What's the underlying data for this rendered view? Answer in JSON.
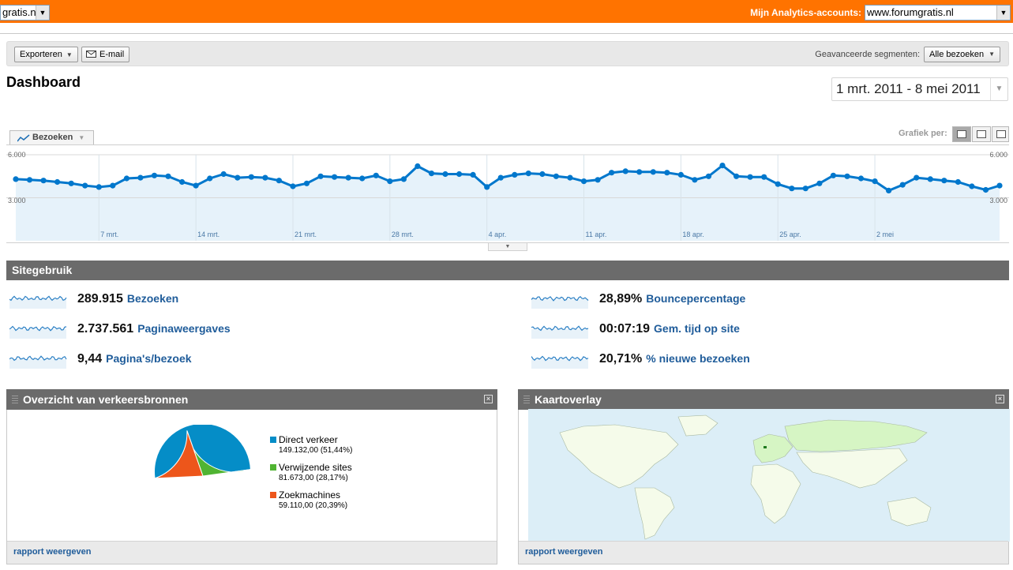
{
  "topbar": {
    "profile_select": "gratis.nl",
    "accounts_label": "Mijn Analytics-accounts:",
    "accounts_select": "www.forumgratis.nl"
  },
  "toolbar": {
    "export_label": "Exporteren",
    "email_label": "E-mail",
    "segments_label": "Geavanceerde segmenten:",
    "segments_value": "Alle bezoeken"
  },
  "page_title": "Dashboard",
  "date_range": "1 mrt. 2011 - 8 mei 2011",
  "chart_tab_label": "Bezoeken",
  "grafiek_label": "Grafiek per:",
  "chart_data": {
    "type": "area",
    "series": [
      {
        "name": "Bezoeken",
        "values": [
          4300,
          4250,
          4200,
          4100,
          4000,
          3850,
          3750,
          3850,
          4350,
          4400,
          4550,
          4500,
          4100,
          3850,
          4350,
          4650,
          4400,
          4450,
          4400,
          4200,
          3800,
          4000,
          4500,
          4450,
          4400,
          4350,
          4550,
          4150,
          4300,
          5200,
          4700,
          4650,
          4650,
          4600,
          3750,
          4400,
          4600,
          4700,
          4650,
          4500,
          4400,
          4150,
          4250,
          4750,
          4850,
          4800,
          4800,
          4750,
          4600,
          4250,
          4500,
          5250,
          4500,
          4450,
          4450,
          3950,
          3650,
          3650,
          4000,
          4550,
          4500,
          4350,
          4150,
          3500,
          3900,
          4400,
          4300,
          4200,
          4100,
          3800,
          3550,
          3850
        ]
      }
    ],
    "x_tick_labels": [
      "7 mrt.",
      "14 mrt.",
      "21 mrt.",
      "28 mrt.",
      "4 apr.",
      "11 apr.",
      "18 apr.",
      "25 apr.",
      "2 mei"
    ],
    "y_tick_labels": [
      "6.000",
      "3.000"
    ],
    "ylim": [
      0,
      6000
    ],
    "grid": true
  },
  "sitegebruik": {
    "title": "Sitegebruik",
    "metrics": [
      {
        "value": "289.915",
        "label": "Bezoeken"
      },
      {
        "value": "2.737.561",
        "label": "Paginaweergaves"
      },
      {
        "value": "9,44",
        "label": "Pagina's/bezoek"
      },
      {
        "value": "28,89%",
        "label": "Bouncepercentage"
      },
      {
        "value": "00:07:19",
        "label": "Gem. tijd op site"
      },
      {
        "value": "20,71%",
        "label": "% nieuwe bezoeken"
      }
    ]
  },
  "traffic_panel": {
    "title": "Overzicht van verkeersbronnen",
    "footer_link": "rapport weergeven",
    "pie": {
      "type": "pie",
      "slices": [
        {
          "name": "Direct verkeer",
          "value_text": "149.132,00 (51,44%)",
          "value": 51.44,
          "color": "#058dc7"
        },
        {
          "name": "Verwijzende sites",
          "value_text": "81.673,00 (28,17%)",
          "value": 28.17,
          "color": "#50b432"
        },
        {
          "name": "Zoekmachines",
          "value_text": "59.110,00 (20,39%)",
          "value": 20.39,
          "color": "#ed561b"
        }
      ]
    }
  },
  "map_panel": {
    "title": "Kaartoverlay",
    "footer_link": "rapport weergeven"
  },
  "colors": {
    "topbar": "#ff7300",
    "line": "#0077cc",
    "area": "#e6f2fa",
    "link": "#1f5c9a",
    "section_bar": "#6b6b6b"
  }
}
